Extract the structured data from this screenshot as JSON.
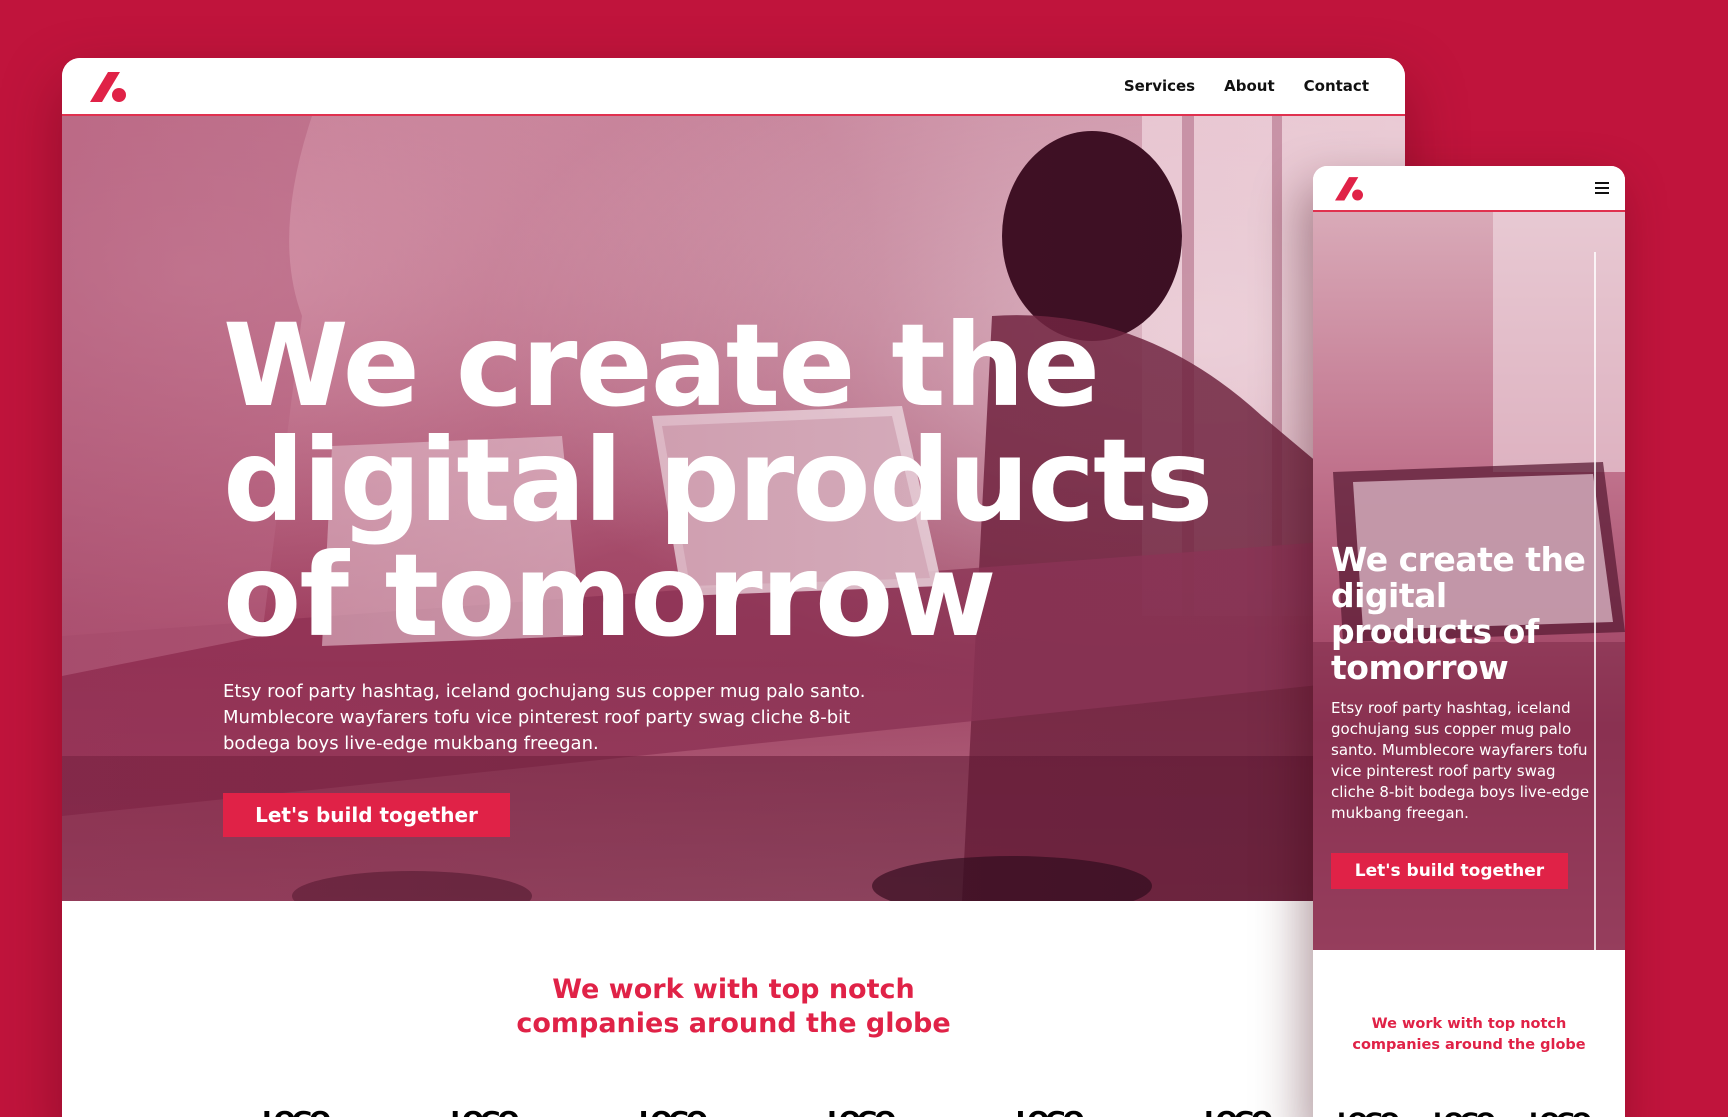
{
  "brand": {
    "accent": "#e02247",
    "background": "#c0143c"
  },
  "desktop": {
    "nav": {
      "logo_icon": "brand-logo-icon",
      "links": [
        "Services",
        "About",
        "Contact"
      ]
    },
    "hero": {
      "headline": "We create the digital products of tomorrow",
      "body": "Etsy roof party hashtag, iceland gochujang sus copper mug palo santo. Mumblecore wayfarers tofu vice pinterest roof party swag cliche 8-bit bodega boys live-edge mukbang freegan.",
      "cta": "Let's build together"
    },
    "partners": {
      "heading_line1": "We work with top notch",
      "heading_line2": "companies around the globe",
      "logos": [
        "LOGO",
        "LOGO",
        "LOGO",
        "LOGO",
        "LOGO",
        "LOGO"
      ]
    }
  },
  "mobile": {
    "nav": {
      "logo_icon": "brand-logo-icon",
      "menu_icon": "hamburger-menu-icon"
    },
    "hero": {
      "headline": "We create the digital products of tomorrow",
      "body": "Etsy roof party hashtag, iceland gochujang sus copper mug palo santo. Mumblecore wayfarers tofu vice pinterest roof party swag cliche 8-bit bodega boys live-edge mukbang freegan.",
      "cta": "Let's build together"
    },
    "partners": {
      "heading": "We work with top notch companies around the globe",
      "logos": [
        "LOGO",
        "LOGO",
        "LOGO"
      ]
    }
  }
}
